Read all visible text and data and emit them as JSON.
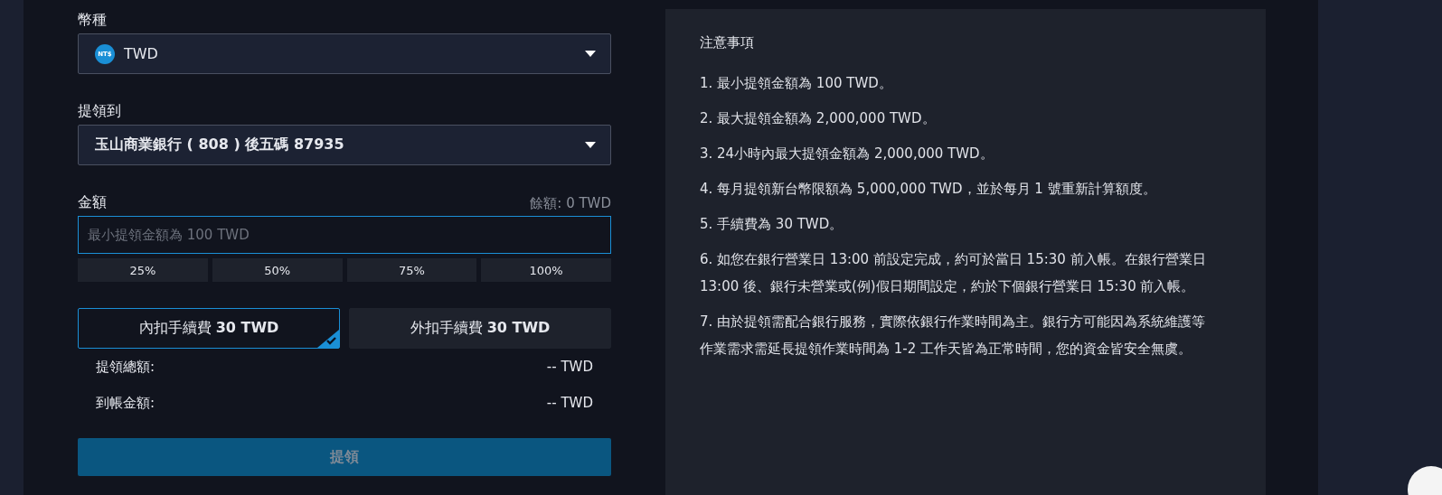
{
  "currency": {
    "label": "幣種",
    "value": "TWD",
    "icon_text": "NT$"
  },
  "withdraw_to": {
    "label": "提領到",
    "value": "玉山商業銀行 ( 808 ) 後五碼 87935"
  },
  "amount": {
    "label": "金額",
    "balance": "餘額: 0 TWD",
    "placeholder": "最小提領金額為 100 TWD"
  },
  "percent_buttons": [
    "25%",
    "50%",
    "75%",
    "100%"
  ],
  "fee_options": [
    {
      "label": "內扣手續費 **30 TWD**",
      "selected": true
    },
    {
      "label": "外扣手續費 **30 TWD**",
      "selected": false
    }
  ],
  "summary": [
    {
      "label": "提領總額:",
      "value": "-- TWD"
    },
    {
      "label": "到帳金額:",
      "value": "-- TWD"
    }
  ],
  "submit": {
    "label": "提領",
    "disabled": true
  },
  "notes": {
    "title": "注意事項",
    "items": [
      "1. 最小提領金額為 100 TWD。",
      "2. 最大提領金額為 2,000,000 TWD。",
      "3. 24小時內最大提領金額為 2,000,000 TWD。",
      "4. 每月提領新台幣限額為 5,000,000 TWD，並於每月 1 號重新計算額度。",
      "5. 手續費為 30 TWD。",
      "6. 如您在銀行營業日 13:00 前設定完成，約可於當日 15:30 前入帳。在銀行營業日 13:00 後、銀行未營業或(例)假日期間設定，約於下個銀行營業日 15:30 前入帳。",
      "7. 由於提領需配合銀行服務，實際依銀行作業時間為主。銀行方可能因為系統維護等作業需求需延長提領作業時間為 1-2 工作天皆為正常時間，您的資金皆安全無虞。"
    ]
  }
}
